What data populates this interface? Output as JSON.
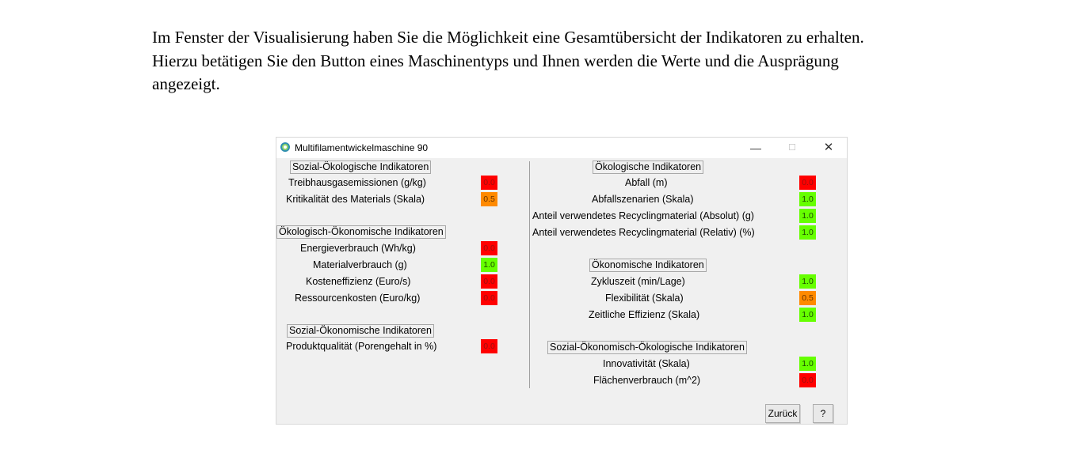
{
  "doc": {
    "line1": "Im Fenster der Visualisierung haben Sie die Möglichkeit eine Gesamtübersicht der Indikatoren zu erhalten.",
    "line2": "Hierzu betätigen Sie den Button eines Maschinentyps und Ihnen werden die Werte und die Ausprägung",
    "line3": "angezeigt."
  },
  "window": {
    "title": "Multifilamentwickelmaschine 90",
    "minimize": "—",
    "maximize": "☐",
    "close": "✕"
  },
  "colors": {
    "red": "#ff0000",
    "orange": "#ff8a00",
    "green": "#66ff00"
  },
  "left": {
    "sections": [
      {
        "title": "Sozial-Ökologische Indikatoren",
        "items": [
          {
            "label": "Treibhausgasemissionen   (g/kg)",
            "value": "0.0",
            "color": "red"
          },
          {
            "label": "Kritikalität des Materials   (Skala)",
            "value": "0.5",
            "color": "orange"
          }
        ]
      },
      {
        "title": "Ökologisch-Ökonomische Indikatoren",
        "items": [
          {
            "label": "Energieverbrauch   (Wh/kg)",
            "value": "0.0",
            "color": "red"
          },
          {
            "label": "Materialverbrauch   (g)",
            "value": "1.0",
            "color": "green"
          },
          {
            "label": "Kosteneffizienz   (Euro/s)",
            "value": "0.0",
            "color": "red"
          },
          {
            "label": "Ressourcenkosten   (Euro/kg)",
            "value": "0.0",
            "color": "red"
          }
        ]
      },
      {
        "title": "Sozial-Ökonomische Indikatoren",
        "items": [
          {
            "label": "Produktqualität  (Porengehalt in %)",
            "value": "0.0",
            "color": "red"
          }
        ]
      }
    ]
  },
  "right": {
    "sections": [
      {
        "title": "Ökologische Indikatoren",
        "items": [
          {
            "label": "Abfall   (m)",
            "value": "0.0",
            "color": "red"
          },
          {
            "label": "Abfallszenarien   (Skala)",
            "value": "1.0",
            "color": "green"
          },
          {
            "label": "Anteil verwendetes Recyclingmaterial (Absolut)   (g)",
            "value": "1.0",
            "color": "green"
          },
          {
            "label": "Anteil verwendetes Recyclingmaterial (Relativ)   (%)",
            "value": "1.0",
            "color": "green"
          }
        ]
      },
      {
        "title": "Ökonomische Indikatoren",
        "items": [
          {
            "label": "Zykluszeit   (min/Lage)",
            "value": "1.0",
            "color": "green"
          },
          {
            "label": "Flexibilität   (Skala)",
            "value": "0.5",
            "color": "orange"
          },
          {
            "label": "Zeitliche Effizienz   (Skala)",
            "value": "1.0",
            "color": "green"
          }
        ]
      },
      {
        "title": "Sozial-Ökonomisch-Ökologische Indikatoren",
        "items": [
          {
            "label": "Innovativität   (Skala)",
            "value": "1.0",
            "color": "green"
          },
          {
            "label": "Flächenverbrauch   (m^2)",
            "value": "0.0",
            "color": "red"
          }
        ]
      }
    ]
  },
  "buttons": {
    "back": "Zurück",
    "help": "?"
  }
}
